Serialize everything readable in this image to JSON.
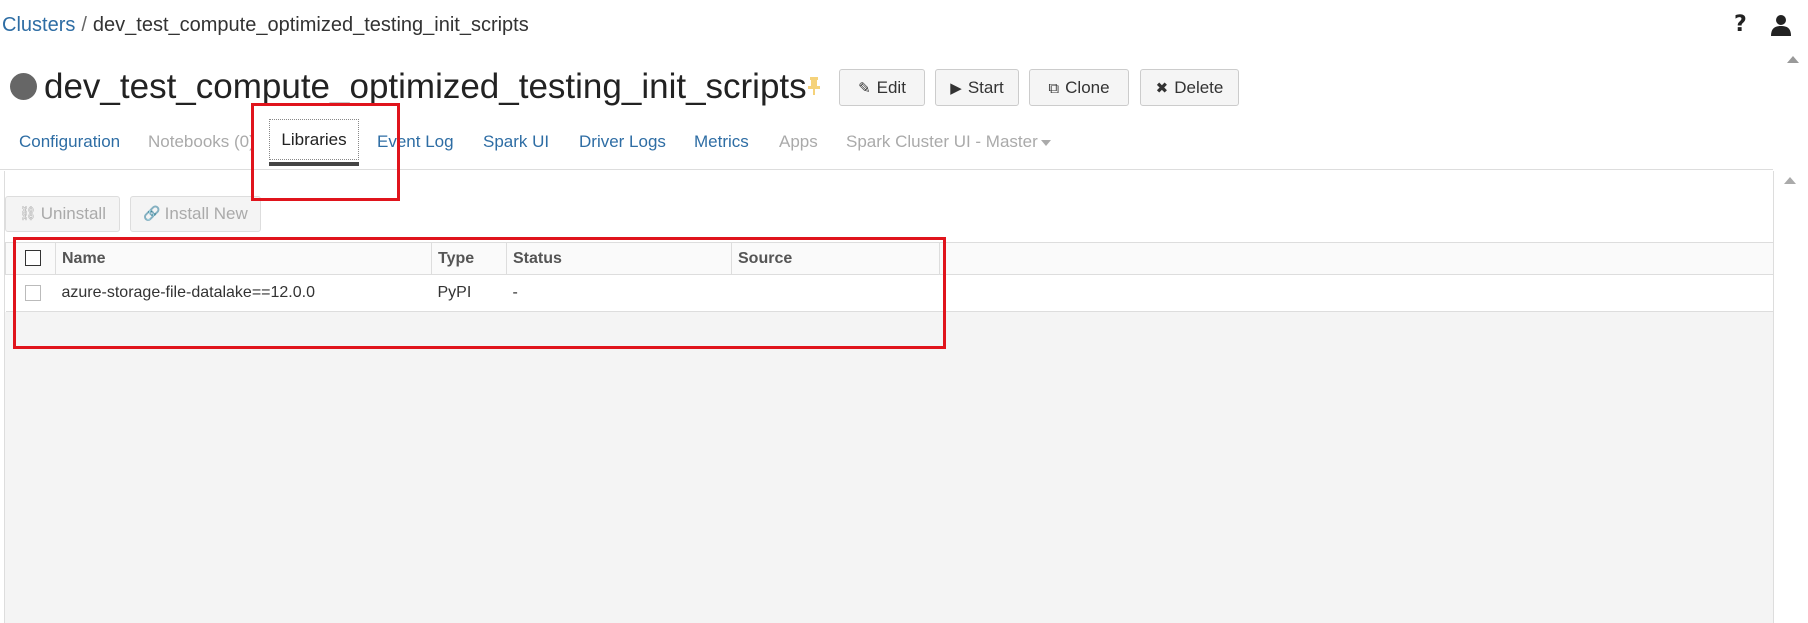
{
  "breadcrumb": {
    "root": "Clusters",
    "separator": "/",
    "current": "dev_test_compute_optimized_testing_init_scripts"
  },
  "top_icons": {
    "help": "?",
    "help_icon": "question-mark",
    "user_icon": "user-silhouette"
  },
  "cluster": {
    "title": "dev_test_compute_optimized_testing_init_scripts",
    "status_color": "#666666",
    "pin_color": "#f5d27a"
  },
  "actions": {
    "edit": "Edit",
    "start": "Start",
    "clone": "Clone",
    "delete": "Delete"
  },
  "tabs": {
    "configuration": "Configuration",
    "notebooks": "Notebooks (0)",
    "libraries": "Libraries",
    "event_log": "Event Log",
    "spark_ui": "Spark UI",
    "driver_logs": "Driver Logs",
    "metrics": "Metrics",
    "apps": "Apps",
    "spark_cluster_ui": "Spark Cluster UI - Master",
    "active": "Libraries"
  },
  "libraries": {
    "uninstall_label": "Uninstall",
    "install_new_label": "Install New",
    "columns": {
      "name": "Name",
      "type": "Type",
      "status": "Status",
      "source": "Source"
    },
    "rows": [
      {
        "name": "azure-storage-file-datalake==12.0.0",
        "type": "PyPI",
        "status": "-",
        "source": ""
      }
    ]
  },
  "colors": {
    "link": "#2e6da4",
    "annotation": "#e0141c",
    "disabled": "#aaaaaa"
  }
}
